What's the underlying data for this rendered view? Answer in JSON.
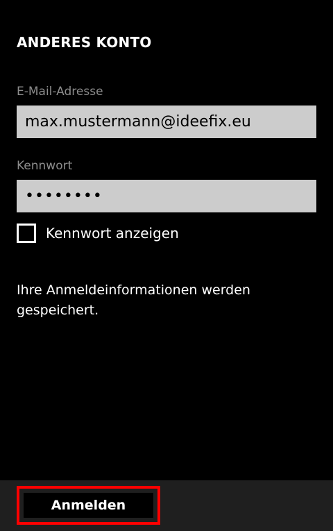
{
  "page": {
    "title": "ANDERES KONTO"
  },
  "form": {
    "email_label": "E-Mail-Adresse",
    "email_value": "max.mustermann@ideefix.eu",
    "password_label": "Kennwort",
    "password_value": "••••••••",
    "show_password_label": "Kennwort anzeigen",
    "show_password_checked": false
  },
  "info": {
    "text": "Ihre Anmeldeinformationen werden gespeichert."
  },
  "app_bar": {
    "signin_label": "Anmelden"
  },
  "colors": {
    "background": "#000000",
    "input_background": "#cccccc",
    "label_gray": "#8c8c8c",
    "app_bar": "#1f1f1f",
    "highlight": "#ff0000"
  }
}
